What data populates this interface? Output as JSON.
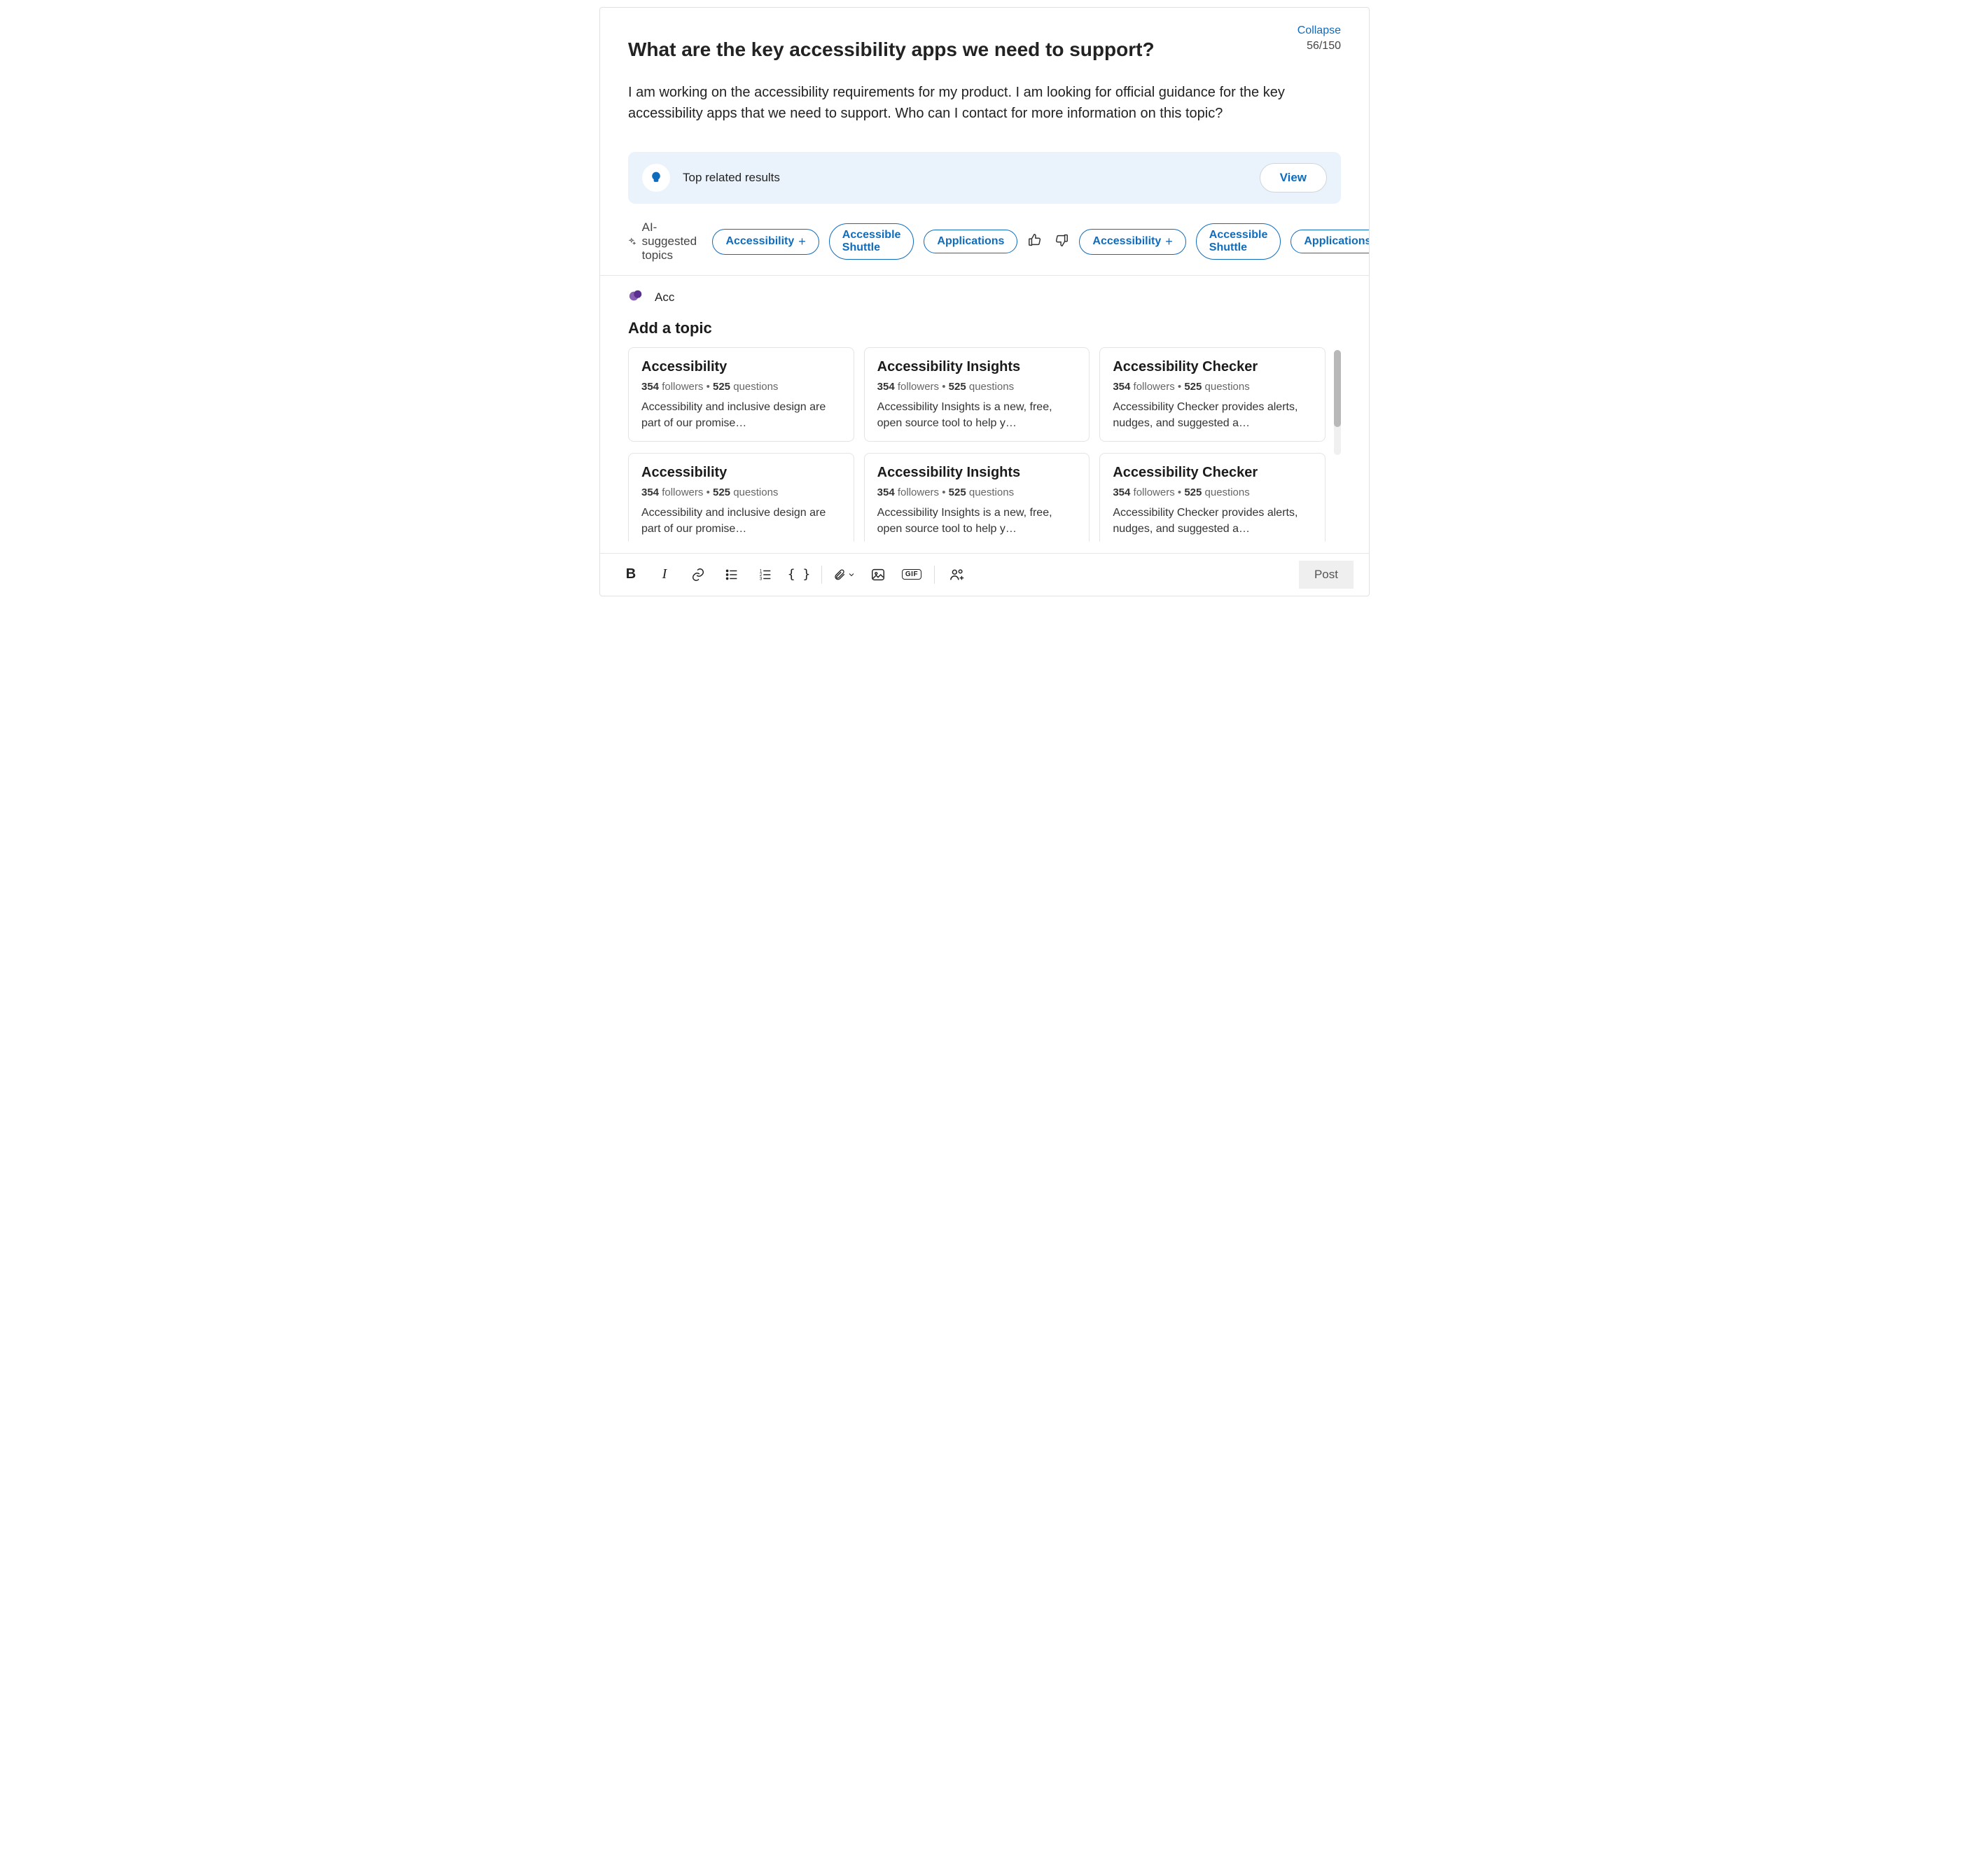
{
  "header": {
    "collapse_label": "Collapse",
    "counter": "56/150",
    "title": "What are the key accessibility apps we need to support?",
    "body": "I am working on the accessibility requirements for my product. I am looking for official guidance for the key accessibility apps that we need to support. Who can I contact for more information on this topic?"
  },
  "related": {
    "label": "Top related results",
    "view_label": "View"
  },
  "ai": {
    "label": "AI-suggested topics",
    "chips": [
      {
        "label": "Accessibility",
        "has_plus": true
      },
      {
        "label": "Accessible Shuttle",
        "has_plus": false
      },
      {
        "label": "Applications",
        "has_plus": false
      }
    ]
  },
  "topic_input": {
    "value": "Acc"
  },
  "add_topic": {
    "title": "Add a topic"
  },
  "topics": [
    {
      "name": "Accessibility",
      "followers": "354",
      "questions": "525",
      "desc": "Accessibility and inclusive design are part of our promise…"
    },
    {
      "name": "Accessibility Insights",
      "followers": "354",
      "questions": "525",
      "desc": "Accessibility Insights is a new, free, open source tool to help y…"
    },
    {
      "name": "Accessibility Checker",
      "followers": "354",
      "questions": "525",
      "desc": "Accessibility Checker provides alerts, nudges, and suggested a…"
    },
    {
      "name": "Accessibility",
      "followers": "354",
      "questions": "525",
      "desc": "Accessibility and inclusive design are part of our promise…"
    },
    {
      "name": "Accessibility Insights",
      "followers": "354",
      "questions": "525",
      "desc": "Accessibility Insights is a new, free, open source tool to help y…"
    },
    {
      "name": "Accessibility Checker",
      "followers": "354",
      "questions": "525",
      "desc": "Accessibility Checker provides alerts, nudges, and suggested a…"
    }
  ],
  "labels": {
    "followers": "followers",
    "questions": "questions",
    "dot": "•",
    "plus": "+"
  },
  "toolbar": {
    "post_label": "Post",
    "gif_label": "GIF"
  }
}
